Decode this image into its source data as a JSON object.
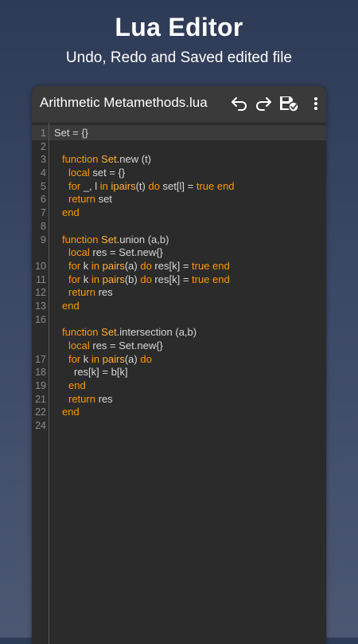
{
  "promo": {
    "title": "Lua Editor",
    "subtitle": "Undo, Redo and Saved edited file"
  },
  "toolbar": {
    "file_name": "Arithmetic Metamethods.lua",
    "icons": [
      "undo-icon",
      "redo-icon",
      "save-icon",
      "more-vert-icon"
    ]
  },
  "colors": {
    "background_top": "#2e3b56",
    "editor_bg": "#2b2b2b",
    "toolbar_bg": "#3a3a3a",
    "keyword": "#ff9900",
    "text": "#d8d8d8",
    "line_number": "#8a8a8a"
  },
  "editor": {
    "line_numbers": [
      "1",
      "2",
      "3",
      "4",
      "5",
      "6",
      "7",
      "8",
      "9",
      "",
      "10",
      "11",
      "12",
      "13",
      "16",
      "",
      "",
      "17",
      "18",
      "19",
      "21",
      "22",
      "24"
    ],
    "lines": [
      {
        "segments": [
          {
            "text": "Set = {}",
            "cls": "tx"
          }
        ]
      },
      {
        "segments": []
      },
      {
        "indent": "i1",
        "segments": [
          {
            "text": "function ",
            "cls": "kw"
          },
          {
            "text": "Set",
            "cls": "fn"
          },
          {
            "text": ".new (t)",
            "cls": "tx"
          }
        ]
      },
      {
        "indent": "i2",
        "segments": [
          {
            "text": "local ",
            "cls": "kw"
          },
          {
            "text": "set = {}",
            "cls": "tx"
          }
        ]
      },
      {
        "indent": "i2",
        "segments": [
          {
            "text": "for ",
            "cls": "kw"
          },
          {
            "text": "_, l ",
            "cls": "tx"
          },
          {
            "text": "in ",
            "cls": "kw"
          },
          {
            "text": "ipairs",
            "cls": "fn"
          },
          {
            "text": "(t) ",
            "cls": "tx"
          },
          {
            "text": "do ",
            "cls": "kw"
          },
          {
            "text": "set[l] = ",
            "cls": "tx"
          },
          {
            "text": "true ",
            "cls": "kw"
          },
          {
            "text": "end",
            "cls": "kw"
          }
        ]
      },
      {
        "indent": "i2",
        "segments": [
          {
            "text": "return ",
            "cls": "kw"
          },
          {
            "text": "set",
            "cls": "tx"
          }
        ]
      },
      {
        "indent": "i1",
        "segments": [
          {
            "text": "end",
            "cls": "kw"
          }
        ]
      },
      {
        "segments": []
      },
      {
        "indent": "i1",
        "segments": [
          {
            "text": "function ",
            "cls": "kw"
          },
          {
            "text": "Set",
            "cls": "fn"
          },
          {
            "text": ".union (a,b)",
            "cls": "tx"
          }
        ]
      },
      {
        "indent": "i2",
        "segments": [
          {
            "text": "local ",
            "cls": "kw"
          },
          {
            "text": "res = Set.new{}",
            "cls": "tx"
          }
        ]
      },
      {
        "indent": "i2",
        "segments": [
          {
            "text": "for ",
            "cls": "kw"
          },
          {
            "text": "k ",
            "cls": "tx"
          },
          {
            "text": "in ",
            "cls": "kw"
          },
          {
            "text": "pairs",
            "cls": "fn"
          },
          {
            "text": "(a) ",
            "cls": "tx"
          },
          {
            "text": "do ",
            "cls": "kw"
          },
          {
            "text": "res[k] = ",
            "cls": "tx"
          },
          {
            "text": "true ",
            "cls": "kw"
          },
          {
            "text": "end",
            "cls": "kw"
          }
        ]
      },
      {
        "indent": "i2",
        "segments": [
          {
            "text": "for ",
            "cls": "kw"
          },
          {
            "text": "k ",
            "cls": "tx"
          },
          {
            "text": "in ",
            "cls": "kw"
          },
          {
            "text": "pairs",
            "cls": "fn"
          },
          {
            "text": "(b) ",
            "cls": "tx"
          },
          {
            "text": "do ",
            "cls": "kw"
          },
          {
            "text": "res[k] = ",
            "cls": "tx"
          },
          {
            "text": "true ",
            "cls": "kw"
          },
          {
            "text": "end",
            "cls": "kw"
          }
        ]
      },
      {
        "indent": "i2",
        "segments": [
          {
            "text": "return ",
            "cls": "kw"
          },
          {
            "text": "res",
            "cls": "tx"
          }
        ]
      },
      {
        "indent": "i1",
        "segments": [
          {
            "text": "end",
            "cls": "kw"
          }
        ]
      },
      {
        "segments": []
      },
      {
        "indent": "i1",
        "segments": [
          {
            "text": "function ",
            "cls": "kw"
          },
          {
            "text": "Set",
            "cls": "fn"
          },
          {
            "text": ".intersection (a,b)",
            "cls": "tx"
          }
        ]
      },
      {
        "indent": "i2",
        "segments": [
          {
            "text": "local ",
            "cls": "kw"
          },
          {
            "text": "res = Set.new{}",
            "cls": "tx"
          }
        ]
      },
      {
        "indent": "i2",
        "segments": [
          {
            "text": "for ",
            "cls": "kw"
          },
          {
            "text": "k ",
            "cls": "tx"
          },
          {
            "text": "in ",
            "cls": "kw"
          },
          {
            "text": "pairs",
            "cls": "fn"
          },
          {
            "text": "(a) ",
            "cls": "tx"
          },
          {
            "text": "do",
            "cls": "kw"
          }
        ]
      },
      {
        "indent": "i3",
        "segments": [
          {
            "text": "res[k] = b[k]",
            "cls": "tx"
          }
        ]
      },
      {
        "indent": "i2",
        "segments": [
          {
            "text": "end",
            "cls": "kw"
          }
        ]
      },
      {
        "indent": "i2",
        "segments": [
          {
            "text": "return ",
            "cls": "kw"
          },
          {
            "text": "res",
            "cls": "tx"
          }
        ]
      },
      {
        "indent": "i1",
        "segments": [
          {
            "text": "end",
            "cls": "kw"
          }
        ]
      }
    ]
  }
}
